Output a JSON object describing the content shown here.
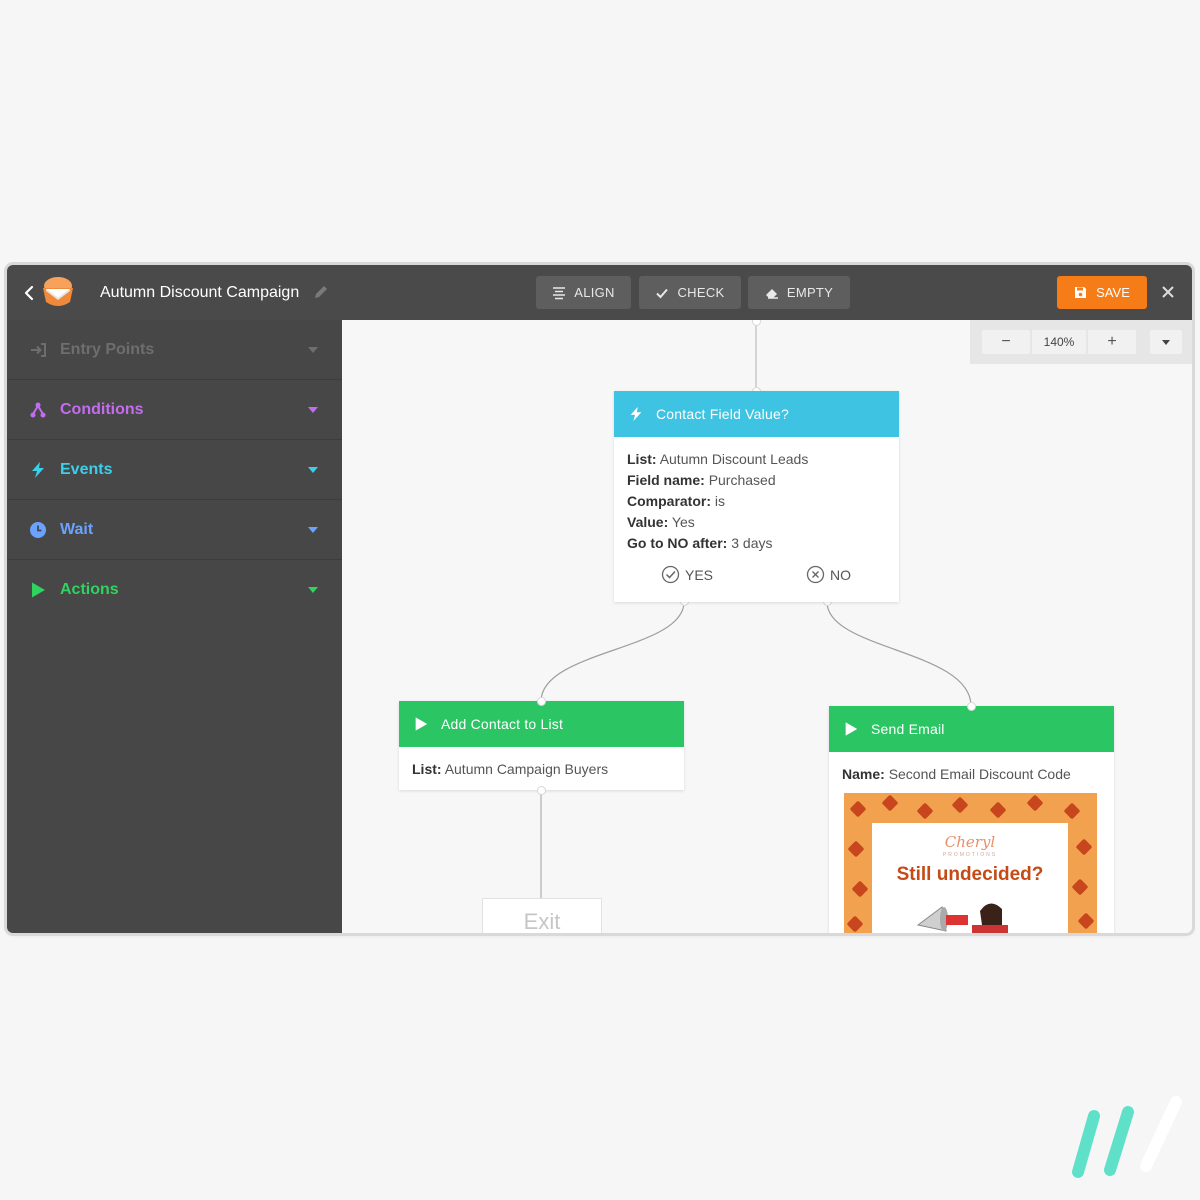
{
  "header": {
    "campaign_title": "Autumn Discount Campaign",
    "toolbar": {
      "align_label": "ALIGN",
      "check_label": "CHECK",
      "empty_label": "EMPTY",
      "save_label": "SAVE"
    }
  },
  "sidebar": {
    "items": [
      {
        "label": "Entry Points",
        "icon": "entry-icon",
        "color": "#6e6e6e"
      },
      {
        "label": "Conditions",
        "icon": "conditions-icon",
        "color": "#c36cf0"
      },
      {
        "label": "Events",
        "icon": "lightning-icon",
        "color": "#3ad0ea"
      },
      {
        "label": "Wait",
        "icon": "clock-icon",
        "color": "#6aa3ff"
      },
      {
        "label": "Actions",
        "icon": "play-icon",
        "color": "#2fd35f"
      }
    ]
  },
  "zoom": {
    "level": "140%"
  },
  "nodes": {
    "condition": {
      "title": "Contact Field Value?",
      "list_label": "List:",
      "list_value": "Autumn Discount Leads",
      "field_label": "Field name:",
      "field_value": "Purchased",
      "comparator_label": "Comparator:",
      "comparator_value": "is",
      "value_label": "Value:",
      "value_value": "Yes",
      "goto_label": "Go to NO after:",
      "goto_value": "3 days",
      "yes_label": "YES",
      "no_label": "NO"
    },
    "add_contact": {
      "title": "Add Contact to List",
      "list_label": "List:",
      "list_value": "Autumn Campaign Buyers"
    },
    "send_email": {
      "title": "Send Email",
      "name_label": "Name:",
      "name_value": "Second Email Discount Code",
      "preview": {
        "brand": "Cheryl",
        "brand_sub": "PROMOTIONS",
        "headline": "Still undecided?"
      }
    },
    "exit": {
      "label": "Exit"
    }
  },
  "colors": {
    "topbar": "#4a4a4a",
    "sidebar": "#474747",
    "save": "#f57c16",
    "event_header": "#3fc3e2",
    "action_header": "#2cc564"
  }
}
